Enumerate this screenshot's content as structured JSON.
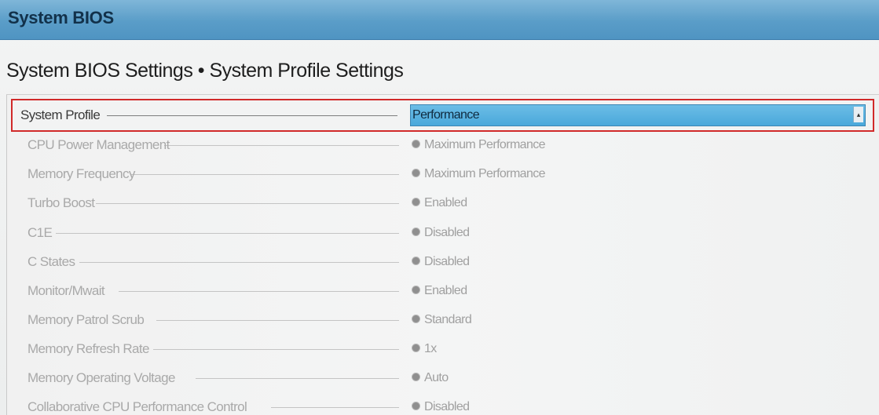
{
  "window": {
    "title": "System BIOS"
  },
  "page": {
    "heading": "System BIOS Settings • System Profile Settings"
  },
  "system_profile": {
    "label": "System Profile",
    "selected": "Performance"
  },
  "settings": [
    {
      "label": "CPU Power Management",
      "value": "Maximum Performance"
    },
    {
      "label": "Memory Frequency",
      "value": "Maximum Performance"
    },
    {
      "label": "Turbo Boost",
      "value": "Enabled"
    },
    {
      "label": "C1E",
      "value": "Disabled"
    },
    {
      "label": "C States",
      "value": "Disabled"
    },
    {
      "label": "Monitor/Mwait",
      "value": "Enabled"
    },
    {
      "label": "Memory Patrol Scrub",
      "value": "Standard"
    },
    {
      "label": "Memory Refresh Rate",
      "value": "1x"
    },
    {
      "label": "Memory Operating Voltage",
      "value": "Auto"
    },
    {
      "label": "Collaborative CPU Performance Control",
      "value": "Disabled"
    }
  ],
  "colors": {
    "titlebar": "#5a9dc8",
    "highlight_border": "#d12a2a",
    "select_bg": "#4aa8db"
  }
}
